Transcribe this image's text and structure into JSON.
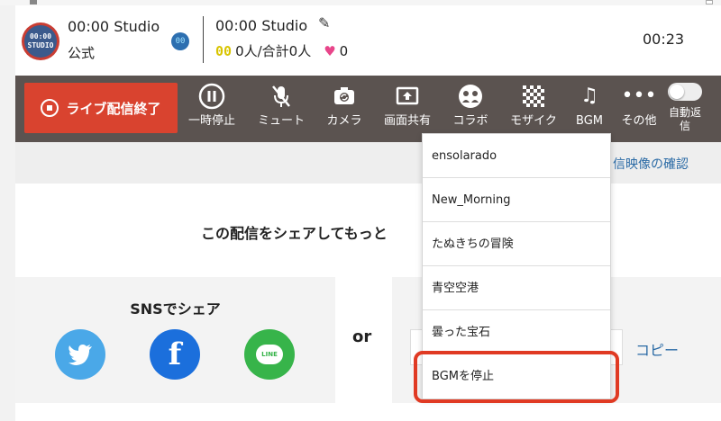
{
  "header": {
    "logo_text_1": "00:00",
    "logo_text_2": "STUDIO",
    "channel_name": "00:00 Studio",
    "channel_subtitle": "公式",
    "badge_text": "00",
    "stream_title": "00:00 Studio",
    "viewer_icon_text": "00",
    "viewers": "0人/合計0人",
    "likes": "0",
    "timer": "00:23"
  },
  "toolbar": {
    "end_live_label": "ライブ配信終了",
    "tools": [
      {
        "label": "一時停止",
        "icon": "pause-icon"
      },
      {
        "label": "ミュート",
        "icon": "mic-off-icon"
      },
      {
        "label": "カメラ",
        "icon": "camera-switch-icon"
      },
      {
        "label": "画面共有",
        "icon": "screen-share-icon"
      },
      {
        "label": "コラボ",
        "icon": "collab-icon"
      },
      {
        "label": "モザイク",
        "icon": "mosaic-icon"
      },
      {
        "label": "BGM",
        "icon": "music-note-icon"
      },
      {
        "label": "その他",
        "icon": "more-icon"
      }
    ],
    "auto_reply_label": "自動返信",
    "auto_reply_on": false
  },
  "content": {
    "confirm_video_link": "信映像の確認",
    "share_prompt": "この配信をシェアしてもっと",
    "sns_title": "SNSでシェア",
    "or_text": "or",
    "copy_label": "コピー",
    "line_logo_text": "LINE"
  },
  "bgm_menu": {
    "items": [
      "ensolarado",
      "New_Morning",
      "たぬきちの冒険",
      "青空空港",
      "曇った宝石",
      "BGMを停止"
    ],
    "highlighted_index": 5
  },
  "colors": {
    "end_button": "#d9432f",
    "toolbar_bg": "#5b5350",
    "highlight_border": "#e03a23",
    "link": "#2a6aa5",
    "heart": "#e8458a"
  }
}
